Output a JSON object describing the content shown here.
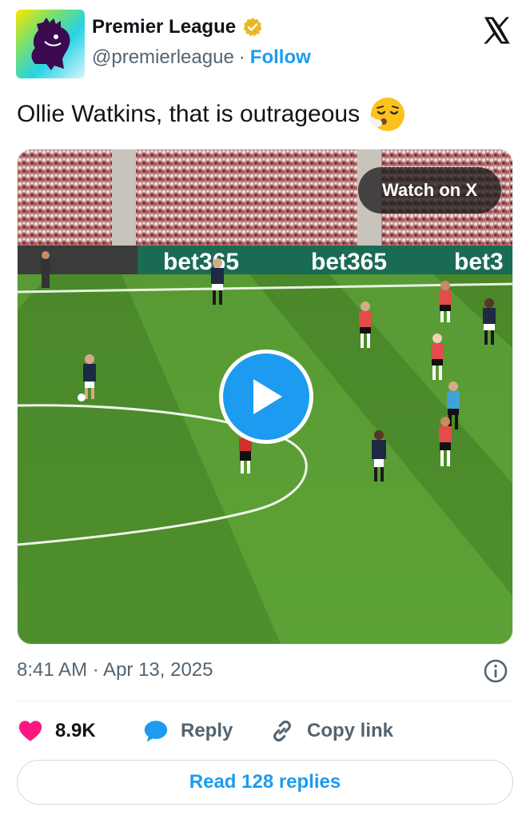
{
  "account": {
    "name": "Premier League",
    "handle": "@premierleague",
    "separator": "·",
    "follow_label": "Follow",
    "verified_color": "#e8b923"
  },
  "tweet": {
    "text": "Ollie Watkins, that is outrageous",
    "emoji_icon": "face-exhaling-emoji"
  },
  "media": {
    "watch_label": "Watch on X",
    "play_icon": "play-icon",
    "boards": [
      "bet365",
      "bet365",
      "bet3"
    ]
  },
  "meta": {
    "timestamp": "8:41 AM · Apr 13, 2025"
  },
  "actions": {
    "like_count": "8.9K",
    "reply_label": "Reply",
    "copy_label": "Copy link"
  },
  "footer": {
    "read_replies_label": "Read 128 replies"
  },
  "colors": {
    "accent": "#1d9bf0",
    "like": "#f91880",
    "text": "#0f1419",
    "muted": "#536471"
  }
}
